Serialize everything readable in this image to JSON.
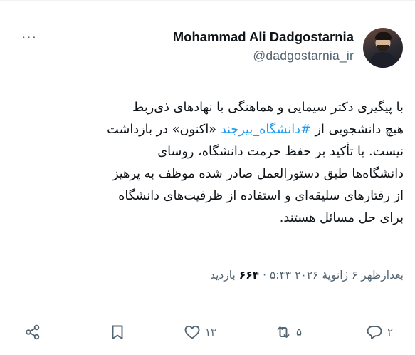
{
  "author": {
    "name": "Mohammad Ali Dadgostarnia",
    "handle": "@dadgostarnia_ir"
  },
  "tweet": {
    "lines": [
      "با پیگیری دکتر سیمایی و هماهنگی با نهادهای ذی‌ربط",
      "نیست. با تأکید بر حفظ حرمت دانشگاه، روسای",
      "دانشگاه‌ها طبق دستورالعمل صادر شده موظف به پرهیز",
      "از رفتارهای سلیقه‌ای و استفاده از ظرفیت‌های دانشگاه",
      "برای حل مسائل هستند."
    ],
    "line2_before": "هیچ دانشجویی از ",
    "hashtag": "#دانشگاه_بیرجند",
    "line2_after": " «اکنون» در بازداشت"
  },
  "meta": {
    "time": "بعدازظهر ۶ ژانویهٔ ۲۰۲۶ ۵:۴۳",
    "separator": " · ",
    "views_count": "۶۶۴",
    "views_label": " بازدید"
  },
  "actions": {
    "reply_count": "۲",
    "retweet_count": "۵",
    "like_count": "۱۳"
  },
  "icons": {
    "more": "more-dots-icon",
    "reply": "reply-bubble-icon",
    "retweet": "retweet-icon",
    "like": "heart-icon",
    "bookmark": "bookmark-icon",
    "share": "share-icon"
  },
  "colors": {
    "hashtag": "#1d9bf0",
    "secondary_text": "#536471",
    "primary_text": "#0f1419"
  }
}
